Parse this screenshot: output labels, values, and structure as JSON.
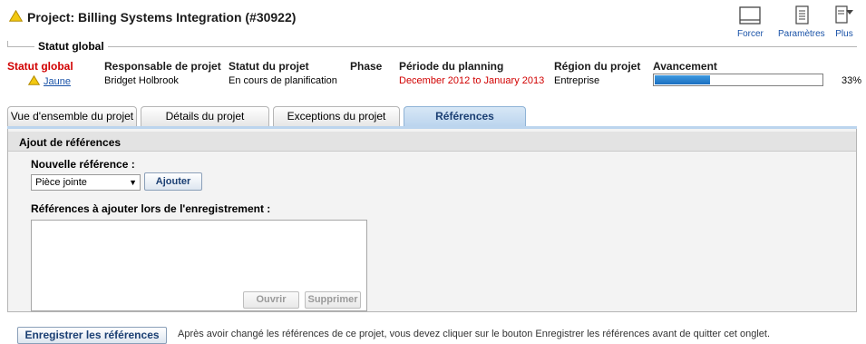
{
  "header": {
    "title": "Project: Billing Systems Integration (#30922)",
    "status_icon": "warning-icon"
  },
  "toolbar": {
    "force_label": "Forcer",
    "params_label": "Paramètres",
    "more_label": "Plus"
  },
  "status_section": {
    "legend": "Statut global",
    "columns": {
      "global_status": {
        "label": "Statut global",
        "value": "Jaune"
      },
      "manager": {
        "label": "Responsable de projet",
        "value": "Bridget Holbrook"
      },
      "project_status": {
        "label": "Statut du projet",
        "value": "En cours de planification"
      },
      "phase": {
        "label": "Phase",
        "value": ""
      },
      "planning_period": {
        "label": "Période du planning",
        "value": "December 2012 to January 2013"
      },
      "region": {
        "label": "Région du projet",
        "value": "Entreprise"
      },
      "progress": {
        "label": "Avancement",
        "value": 33,
        "value_text": "33%"
      }
    },
    "colors": {
      "alert": "#d10000",
      "warning": "#f2c811",
      "progress": "#1b6fc0"
    }
  },
  "tabs": [
    {
      "label": "Vue d'ensemble du projet"
    },
    {
      "label": "Détails du projet"
    },
    {
      "label": "Exceptions du projet"
    },
    {
      "label": "Références",
      "active": true
    }
  ],
  "panel": {
    "title": "Ajout de références",
    "new_ref_label": "Nouvelle référence :",
    "select_value": "Pièce jointe",
    "add_button": "Ajouter",
    "to_add_label": "Références à ajouter lors de l'enregistrement :",
    "open_button": "Ouvrir",
    "delete_button": "Supprimer"
  },
  "footer": {
    "save_button": "Enregistrer les références",
    "note": "Après avoir changé les références de ce projet, vous devez cliquer sur le bouton Enregistrer les références avant de quitter cet onglet."
  }
}
